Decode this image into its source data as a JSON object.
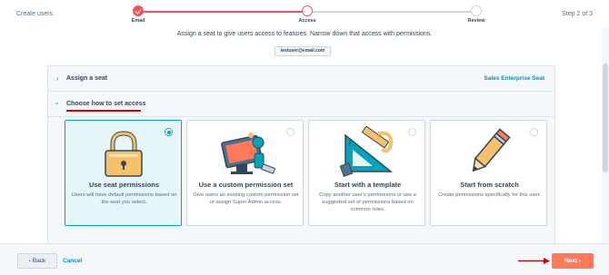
{
  "header": {
    "title": "Create users",
    "step_counter": "Step 2 of 3",
    "steps": [
      {
        "label": "Email",
        "state": "done"
      },
      {
        "label": "Access",
        "state": "current"
      },
      {
        "label": "Review",
        "state": "upcoming"
      }
    ]
  },
  "main": {
    "subtitle": "Assign a seat to give users access to features. Narrow down that access with permissions.",
    "email_chip": "testuser@email.com",
    "assign_seat": {
      "label": "Assign a seat",
      "value": "Sales Enterprise Seat"
    },
    "access_section": {
      "label": "Choose how to set access"
    },
    "options": [
      {
        "title": "Use seat permissions",
        "description": "Users will have default permissions based on the seat you select.",
        "selected": true,
        "icon": "padlock-icon"
      },
      {
        "title": "Use a custom permission set",
        "description": "Give users an existing custom permission set or assign Super Admin access.",
        "selected": false,
        "icon": "computer-tools-icon"
      },
      {
        "title": "Start with a template",
        "description": "Copy another user's permissions or use a suggested set of permissions based on common roles.",
        "selected": false,
        "icon": "drafting-tools-icon"
      },
      {
        "title": "Start from scratch",
        "description": "Create permissions specifically for this user.",
        "selected": false,
        "icon": "pencil-icon"
      }
    ]
  },
  "footer": {
    "back_label": "Back",
    "cancel_label": "Cancel",
    "next_label": "Next"
  },
  "colors": {
    "accent": "#ff7a59",
    "progress": "#f2545b",
    "link": "#0091ae",
    "selected_border": "#00a4bd",
    "annotation_red": "#d20000"
  }
}
